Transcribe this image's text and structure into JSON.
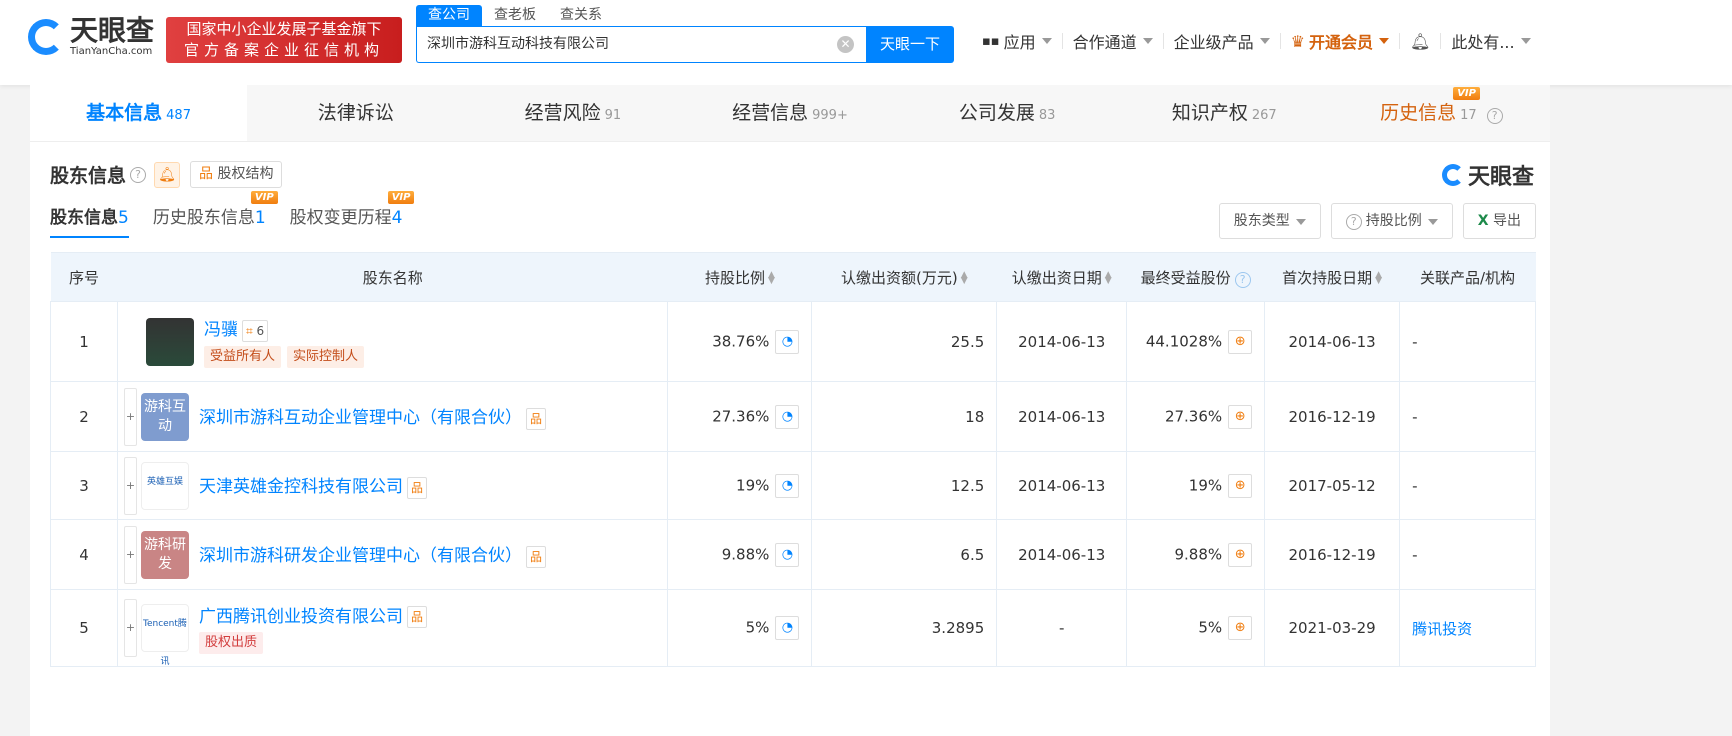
{
  "header": {
    "logo_cn": "天眼查",
    "logo_en": "TianYanCha.com",
    "banner_line1": "国家中小企业发展子基金旗下",
    "banner_line2": "官方备案企业征信机构",
    "search_tabs": [
      "查公司",
      "查老板",
      "查关系"
    ],
    "search_value": "深圳市游科互动科技有限公司",
    "search_button": "天眼一下",
    "nav": [
      "应用",
      "合作通道",
      "企业级产品",
      "开通会员",
      "此处有..."
    ]
  },
  "main_tabs": [
    {
      "label": "基本信息",
      "count": "487"
    },
    {
      "label": "法律诉讼",
      "count": ""
    },
    {
      "label": "经营风险",
      "count": "91"
    },
    {
      "label": "经营信息",
      "count": "999+"
    },
    {
      "label": "公司发展",
      "count": "83"
    },
    {
      "label": "知识产权",
      "count": "267"
    },
    {
      "label": "历史信息",
      "count": "17",
      "vip": "VIP"
    }
  ],
  "section": {
    "title": "股东信息",
    "equity_structure": "股权结构",
    "brand": "天眼查"
  },
  "sub_tabs": [
    {
      "label": "股东信息",
      "count": "5"
    },
    {
      "label": "历史股东信息",
      "count": "1",
      "vip": "VIP"
    },
    {
      "label": "股权变更历程",
      "count": "4",
      "vip": "VIP"
    }
  ],
  "controls": {
    "type": "股东类型",
    "ratio": "持股比例",
    "export": "导出"
  },
  "columns": [
    "序号",
    "股东名称",
    "持股比例",
    "认缴出资额(万元)",
    "认缴出资日期",
    "最终受益股份",
    "首次持股日期",
    "关联产品/机构"
  ],
  "rows": [
    {
      "no": "1",
      "name": "冯骥",
      "avatar": "photo",
      "eq_count": "6",
      "tags": [
        "受益所有人",
        "实际控制人"
      ],
      "ratio": "38.76%",
      "amount": "25.5",
      "date": "2014-06-13",
      "final": "44.1028%",
      "first": "2014-06-13",
      "related": "-"
    },
    {
      "no": "2",
      "name": "深圳市游科互动企业管理中心（有限合伙）",
      "avatar": "游科互动",
      "avatar_color": "#7f9ccf",
      "ratio": "27.36%",
      "amount": "18",
      "date": "2014-06-13",
      "final": "27.36%",
      "first": "2016-12-19",
      "related": "-"
    },
    {
      "no": "3",
      "name": "天津英雄金控科技有限公司",
      "avatar": "英雄互娱",
      "avatar_color": "logo",
      "ratio": "19%",
      "amount": "12.5",
      "date": "2014-06-13",
      "final": "19%",
      "first": "2017-05-12",
      "related": "-"
    },
    {
      "no": "4",
      "name": "深圳市游科研发企业管理中心（有限合伙）",
      "avatar": "游科研发",
      "avatar_color": "#c98585",
      "ratio": "9.88%",
      "amount": "6.5",
      "date": "2014-06-13",
      "final": "9.88%",
      "first": "2016-12-19",
      "related": "-"
    },
    {
      "no": "5",
      "name": "广西腾讯创业投资有限公司",
      "avatar": "Tencent腾讯",
      "avatar_color": "logo",
      "tags_red": [
        "股权出质"
      ],
      "ratio": "5%",
      "amount": "3.2895",
      "date": "-",
      "final": "5%",
      "first": "2021-03-29",
      "related": "腾讯投资",
      "related_link": true
    }
  ]
}
